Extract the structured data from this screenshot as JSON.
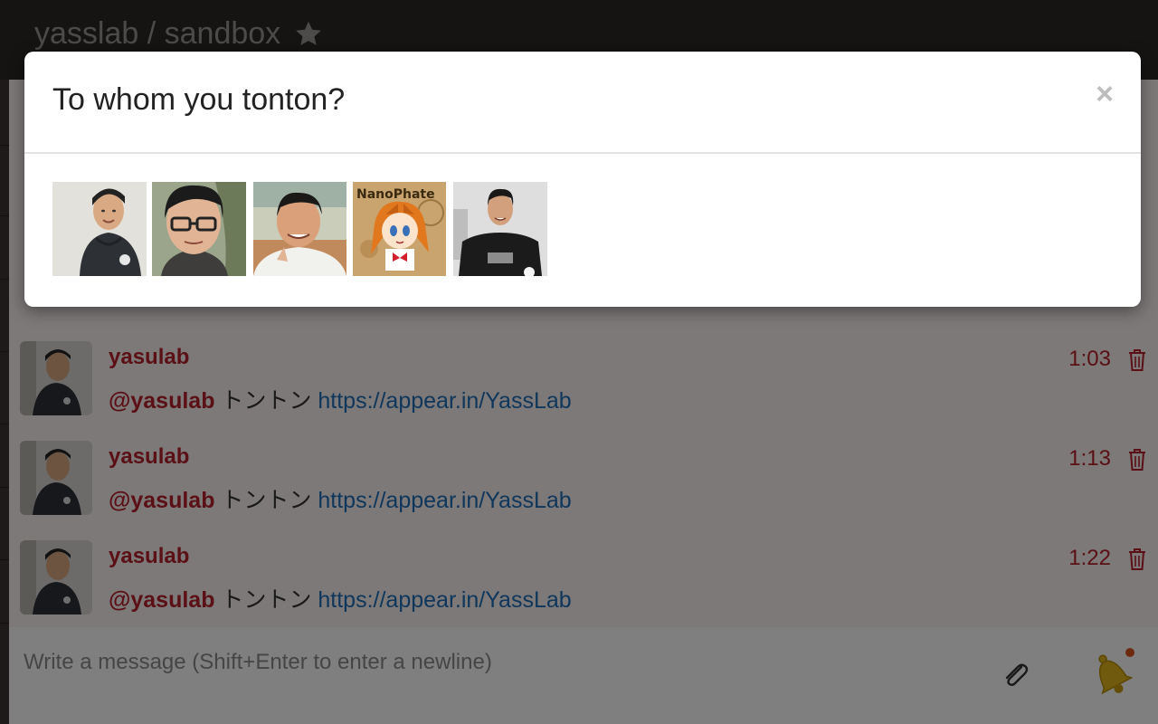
{
  "header": {
    "title": "yasslab / sandbox",
    "star_icon": "star-icon"
  },
  "modal": {
    "title": "To whom you tonton?",
    "close_label": "×",
    "users": [
      {
        "name": "yasulab",
        "avatar": "hoodie-photo"
      },
      {
        "name": "user-glasses",
        "avatar": "glasses-photo"
      },
      {
        "name": "user-outdoor",
        "avatar": "outdoor-photo"
      },
      {
        "name": "NanoPhate",
        "avatar": "anime-illustration",
        "badge": "NanoPhate"
      },
      {
        "name": "user-black-tee",
        "avatar": "black-tee-photo"
      }
    ]
  },
  "messages": [
    {
      "user": "yasulab",
      "mention": "@yasulab",
      "text": " トントン ",
      "link": "https://appear.in/YassLab",
      "time": "1:03"
    },
    {
      "user": "yasulab",
      "mention": "@yasulab",
      "text": " トントン ",
      "link": "https://appear.in/YassLab",
      "time": "1:13"
    },
    {
      "user": "yasulab",
      "mention": "@yasulab",
      "text": " トントン ",
      "link": "https://appear.in/YassLab",
      "time": "1:22"
    }
  ],
  "composer": {
    "placeholder": "Write a message (Shift+Enter to enter a newline)"
  },
  "colors": {
    "brand_red": "#b5202a",
    "link_blue": "#1e6db6",
    "topbar": "#2b2826",
    "bell_gold": "#e0b51a"
  }
}
